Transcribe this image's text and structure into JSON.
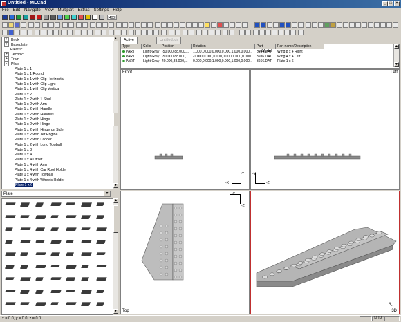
{
  "window": {
    "title": "Untitled - MLCad"
  },
  "menu": [
    "File",
    "Edit",
    "Navigate",
    "View",
    "Multipart",
    "Extras",
    "Settings",
    "Help"
  ],
  "toolbar": {
    "zoom_value": "[400]"
  },
  "tree": {
    "items": [
      {
        "label": "Brick",
        "expander": "+",
        "level": 0
      },
      {
        "label": "Baseplate",
        "expander": "+",
        "level": 0
      },
      {
        "label": "Electric",
        "expander": "",
        "level": 0
      },
      {
        "label": "Technic",
        "expander": "+",
        "level": 0
      },
      {
        "label": "Train",
        "expander": "+",
        "level": 0
      },
      {
        "label": "Plate",
        "expander": "-",
        "level": 0
      },
      {
        "label": "Plate  1 x  1",
        "level": 1
      },
      {
        "label": "Plate  1 x  1 Round",
        "level": 1
      },
      {
        "label": "Plate  1 x  1 with Clip Horizontal",
        "level": 1
      },
      {
        "label": "Plate  1 x  1 with Clip Light",
        "level": 1
      },
      {
        "label": "Plate  1 x  1 with Clip Vertical",
        "level": 1
      },
      {
        "label": "Plate  1 x  2",
        "level": 1
      },
      {
        "label": "Plate  1 x  2 with 1 Stud",
        "level": 1
      },
      {
        "label": "Plate  1 x  2 with Arm",
        "level": 1
      },
      {
        "label": "Plate  1 x  2 with Handle",
        "level": 1
      },
      {
        "label": "Plate  1 x  2 with Handles",
        "level": 1
      },
      {
        "label": "Plate  1 x  2 with Hinge",
        "level": 1
      },
      {
        "label": "Plate  1 x  2 with Hinge",
        "level": 1
      },
      {
        "label": "Plate  1 x  2 with Hinge on Side",
        "level": 1
      },
      {
        "label": "Plate  1 x  2 with Jet Engine",
        "level": 1
      },
      {
        "label": "Plate  1 x  2 with Ladder",
        "level": 1
      },
      {
        "label": "Plate  1 x  2 with Long Towball",
        "level": 1
      },
      {
        "label": "Plate  1 x  3",
        "level": 1
      },
      {
        "label": "Plate  1 x  4",
        "level": 1
      },
      {
        "label": "Plate  1 x  4 Offset",
        "level": 1
      },
      {
        "label": "Plate  1 x  4 with Arm",
        "level": 1
      },
      {
        "label": "Plate  1 x  4 with Car Roof Holder",
        "level": 1
      },
      {
        "label": "Plate  1 x  4 with Towball",
        "level": 1
      },
      {
        "label": "Plate  1 x  4 with Wheels Holder",
        "level": 1
      },
      {
        "label": "Plate  1 x  6",
        "level": 1,
        "selected": true
      }
    ]
  },
  "category_combo": {
    "value": "Plate"
  },
  "tabs": [
    {
      "label": "Active Model"
    },
    {
      "label": "Untitled.ldr"
    }
  ],
  "model_table": {
    "headers": [
      "Type",
      "Color",
      "Position",
      "Rotation",
      "Part no./Model",
      "Part name/Description"
    ],
    "rows": [
      [
        "PART",
        "Light-Gray",
        "-50.000,88.000,...",
        "1.000,0.000,0.000,0.000,1.000,0.000...",
        "3934.DAT",
        "Wing  8 x  4 Right"
      ],
      [
        "PART",
        "Light-Gray",
        "-50.000,88.000,...",
        "-1.000,0.000,0.000,0.000,1.000,0.000...",
        "3936.DAT",
        "Wing  4 x  4 Left"
      ],
      [
        "PART",
        "Light-Gray",
        "40.000,88.000,...",
        "0.000,0.000,1.000,0.000,1.000,0.000...",
        "3666.DAT",
        "Plate  1 x  6"
      ]
    ]
  },
  "viewports": {
    "front": {
      "label": "Front",
      "axis_a": "-Y",
      "axis_b": "-X"
    },
    "left": {
      "label": "Left",
      "axis_a": "-Y",
      "axis_b": "-Z"
    },
    "top": {
      "label": "Top",
      "axis_a": "-X",
      "axis_b": "-Z"
    },
    "three_d": {
      "label": "3D"
    }
  },
  "status": {
    "coords": "x = 0.0,  y = 0.0,  z = 0.0",
    "num": "NUM"
  },
  "colors": {
    "title_bar": "#0a246a",
    "selection": "#0a246a",
    "active_view_border": "#c03030",
    "part_gray": "#9a9a9a"
  }
}
